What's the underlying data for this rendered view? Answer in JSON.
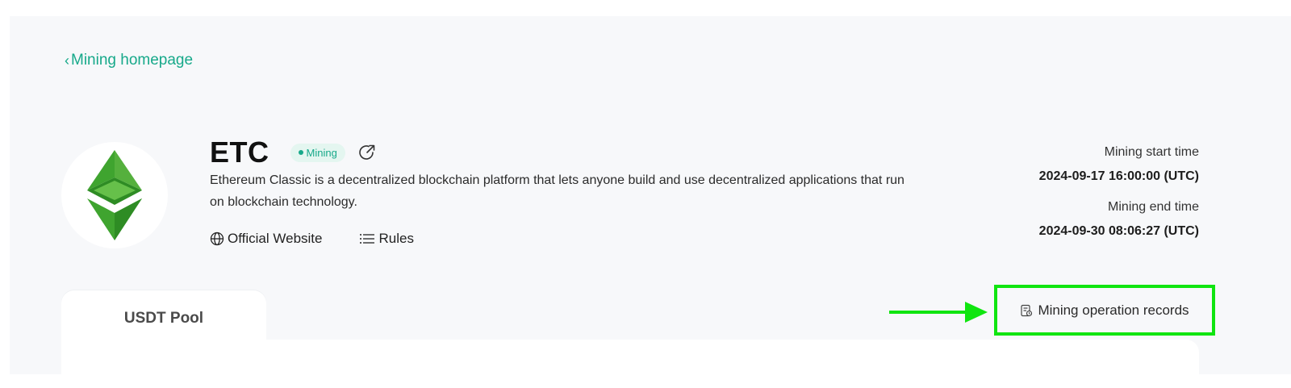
{
  "nav": {
    "back_label": "Mining homepage"
  },
  "coin": {
    "symbol": "ETC",
    "status": "Mining",
    "description": "Ethereum Classic is a decentralized blockchain platform that lets anyone build and use decentralized applications that run on blockchain technology."
  },
  "links": {
    "website": "Official Website",
    "rules": "Rules"
  },
  "times": {
    "start_label": "Mining start time",
    "start_value": "2024-09-17 16:00:00 (UTC)",
    "end_label": "Mining end time",
    "end_value": "2024-09-30 08:06:27 (UTC)"
  },
  "tabs": [
    {
      "label": "USDT Pool"
    }
  ],
  "records": {
    "label": "Mining operation records"
  },
  "colors": {
    "accent": "#17a98a",
    "highlight": "#10e510",
    "panel": "#f7f8fa"
  }
}
